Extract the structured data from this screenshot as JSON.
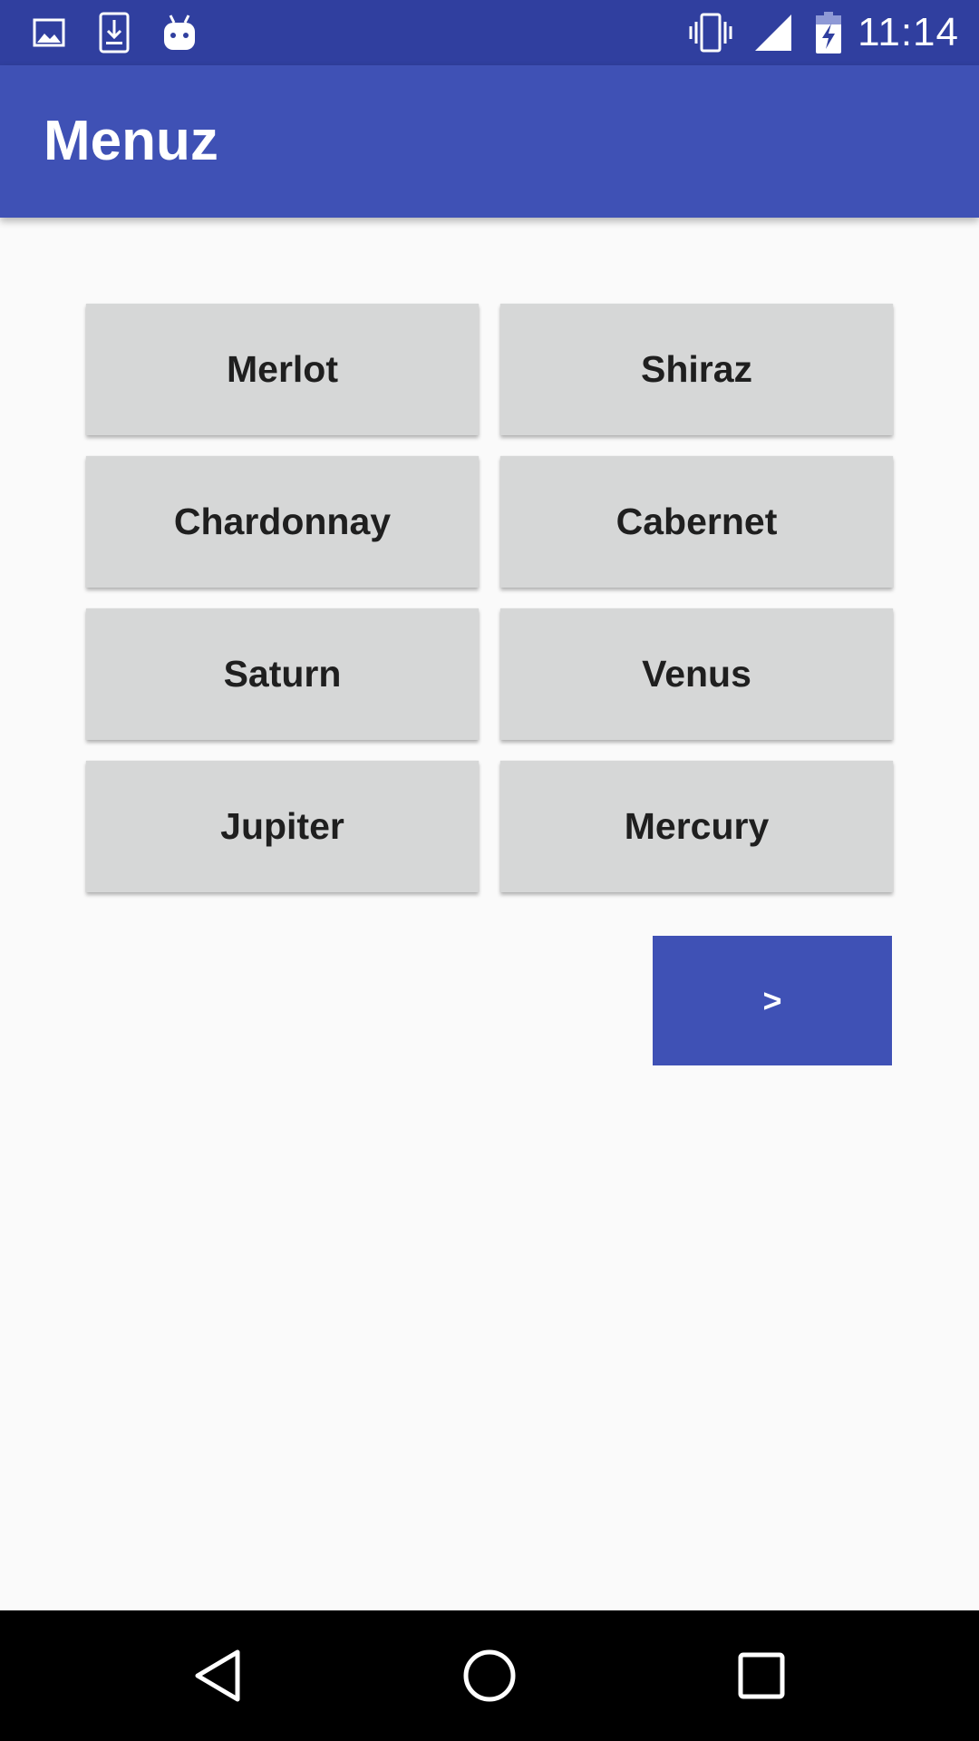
{
  "status_bar": {
    "time": "11:14",
    "left_icons": [
      "image-icon",
      "download-icon",
      "android-icon"
    ],
    "right_icons": [
      "vibrate-icon",
      "signal-icon",
      "battery-charging-icon"
    ]
  },
  "app_bar": {
    "title": "Menuz"
  },
  "menu": {
    "items": [
      {
        "label": "Merlot"
      },
      {
        "label": "Shiraz"
      },
      {
        "label": "Chardonnay"
      },
      {
        "label": "Cabernet"
      },
      {
        "label": "Saturn"
      },
      {
        "label": "Venus"
      },
      {
        "label": "Jupiter"
      },
      {
        "label": "Mercury"
      }
    ],
    "next_label": ">"
  },
  "nav_bar": {
    "buttons": [
      "back-icon",
      "home-icon",
      "recents-icon"
    ]
  },
  "colors": {
    "status_bar": "#303f9f",
    "app_bar": "#3f51b5",
    "accent_button": "#3f51b5",
    "menu_button": "#d6d7d7",
    "background": "#fafafa"
  }
}
